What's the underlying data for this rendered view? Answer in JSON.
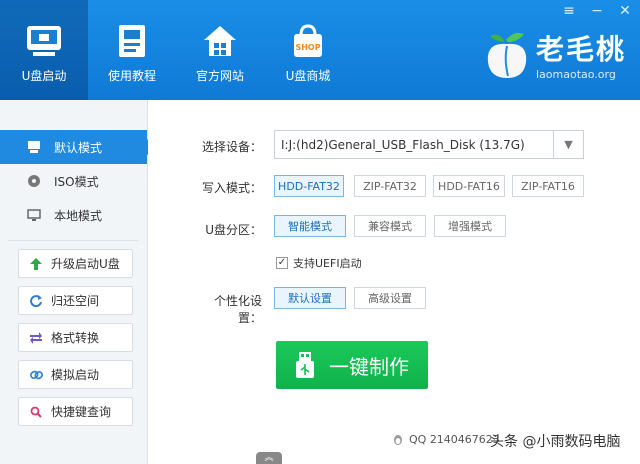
{
  "nav": [
    {
      "label": "U盘启动",
      "icon": "usb-drive-icon"
    },
    {
      "label": "使用教程",
      "icon": "book-icon"
    },
    {
      "label": "官方网站",
      "icon": "home-icon"
    },
    {
      "label": "U盘商城",
      "icon": "shop-bag-icon"
    }
  ],
  "shop_badge": "SHOP",
  "logo": {
    "cn": "老毛桃",
    "en": "laomaotao.org"
  },
  "window_controls": [
    "≡",
    "−",
    "✕"
  ],
  "modes": [
    {
      "label": "默认模式",
      "icon": "usb-drive-icon",
      "active": true
    },
    {
      "label": "ISO模式",
      "icon": "disc-icon",
      "active": false
    },
    {
      "label": "本地模式",
      "icon": "monitor-icon",
      "active": false
    }
  ],
  "tools": [
    {
      "label": "升级启动U盘",
      "icon": "up-arrow-icon",
      "color": "#2ea84a"
    },
    {
      "label": "归还空间",
      "icon": "refresh-icon",
      "color": "#2b7fd1"
    },
    {
      "label": "格式转换",
      "icon": "swap-arrows-icon",
      "color": "#6b59c9"
    },
    {
      "label": "模拟启动",
      "icon": "link-icon",
      "color": "#2b7fd1"
    },
    {
      "label": "快捷键查询",
      "icon": "search-icon",
      "color": "#d6396a"
    }
  ],
  "device": {
    "label": "选择设备：",
    "value": "I:J:(hd2)General_USB_Flash_Disk (13.7G)"
  },
  "write_mode": {
    "label": "写入模式：",
    "options": [
      "HDD-FAT32",
      "ZIP-FAT32",
      "HDD-FAT16",
      "ZIP-FAT16"
    ],
    "selected": "HDD-FAT32"
  },
  "partition": {
    "label": "U盘分区：",
    "options": [
      "智能模式",
      "兼容模式",
      "增强模式"
    ],
    "selected": "智能模式"
  },
  "uefi": {
    "label": "支持UEFI启动",
    "checked": true
  },
  "personal": {
    "label": "个性化设置：",
    "options": [
      "默认设置",
      "高级设置"
    ],
    "selected": "默认设置"
  },
  "make_button": "一键制作",
  "qq": "QQ 2140467623",
  "watermark": "头条 @小雨数码电脑",
  "colors": {
    "header": "#1a8ee6",
    "accent": "#1f8ae0",
    "make": "#14bf53"
  }
}
